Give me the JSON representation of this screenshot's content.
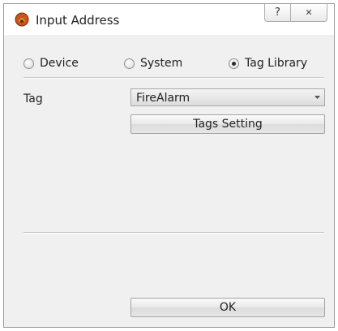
{
  "window": {
    "title": "Input Address",
    "help_glyph": "?",
    "close_glyph": "✕"
  },
  "source": {
    "options": [
      {
        "label": "Device",
        "checked": false
      },
      {
        "label": "System",
        "checked": false
      },
      {
        "label": "Tag Library",
        "checked": true
      }
    ]
  },
  "tag": {
    "label": "Tag",
    "selected": "FireAlarm"
  },
  "buttons": {
    "tags_setting": "Tags Setting",
    "ok": "OK"
  },
  "colors": {
    "app_icon": "#c8561c",
    "background": "#f0f0f0"
  },
  "icons": {
    "app": "app-flame-icon",
    "help": "help-icon",
    "close": "close-icon",
    "dropdown": "chevron-down-icon"
  }
}
